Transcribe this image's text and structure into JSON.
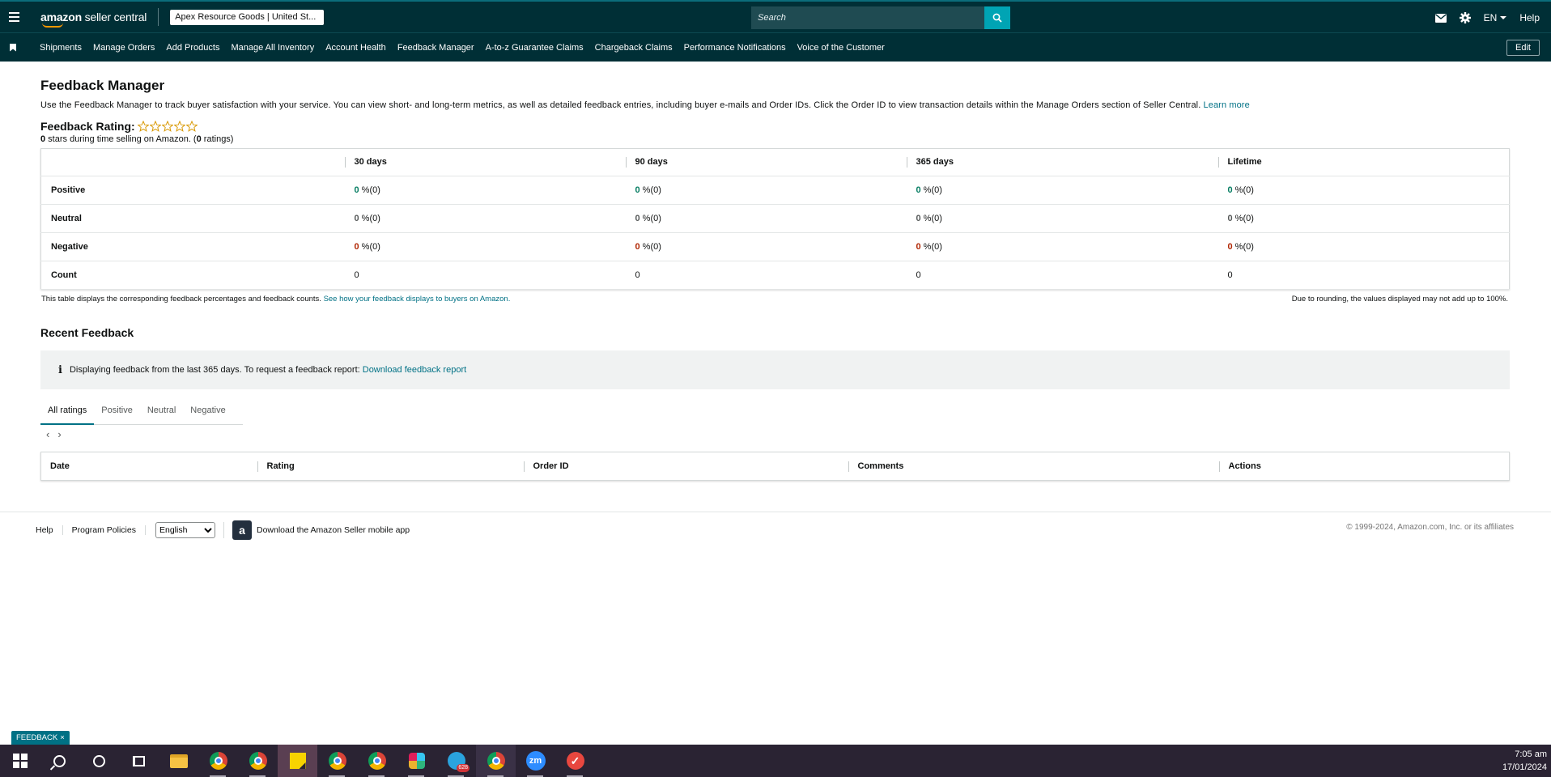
{
  "header": {
    "logo_main": "amazon",
    "logo_sub": " seller central",
    "account": "Apex Resource Goods | United St...",
    "search_placeholder": "Search",
    "lang": "EN",
    "help": "Help"
  },
  "nav": {
    "items": [
      "Shipments",
      "Manage Orders",
      "Add Products",
      "Manage All Inventory",
      "Account Health",
      "Feedback Manager",
      "A-to-z Guarantee Claims",
      "Chargeback Claims",
      "Performance Notifications",
      "Voice of the Customer"
    ],
    "edit": "Edit"
  },
  "page": {
    "title": "Feedback Manager",
    "description": "Use the Feedback Manager to track buyer satisfaction with your service. You can view short- and long-term metrics, as well as detailed feedback entries, including buyer e-mails and Order IDs. Click the Order ID to view transaction details within the Manage Orders section of Seller Central.",
    "learn_more": "Learn more",
    "rating_label": "Feedback Rating:",
    "stars_count": "0",
    "stars_text": " stars during time selling on Amazon. (",
    "ratings_count": "0",
    "ratings_text": " ratings)"
  },
  "feedback_table": {
    "columns": [
      "30 days",
      "90 days",
      "365 days",
      "Lifetime"
    ],
    "rows": [
      {
        "label": "Positive",
        "cells": [
          {
            "n": "0",
            "rest": " %(0)"
          },
          {
            "n": "0",
            "rest": " %(0)"
          },
          {
            "n": "0",
            "rest": " %(0)"
          },
          {
            "n": "0",
            "rest": " %(0)"
          }
        ]
      },
      {
        "label": "Neutral",
        "cells": [
          {
            "n": "0",
            "rest": " %(0)"
          },
          {
            "n": "0",
            "rest": " %(0)"
          },
          {
            "n": "0",
            "rest": " %(0)"
          },
          {
            "n": "0",
            "rest": " %(0)"
          }
        ]
      },
      {
        "label": "Negative",
        "cells": [
          {
            "n": "0",
            "rest": " %(0)"
          },
          {
            "n": "0",
            "rest": " %(0)"
          },
          {
            "n": "0",
            "rest": " %(0)"
          },
          {
            "n": "0",
            "rest": " %(0)"
          }
        ]
      },
      {
        "label": "Count",
        "cells": [
          {
            "n": "",
            "rest": "0"
          },
          {
            "n": "",
            "rest": "0"
          },
          {
            "n": "",
            "rest": "0"
          },
          {
            "n": "",
            "rest": "0"
          }
        ]
      }
    ],
    "note_left": "This table displays the corresponding feedback percentages and feedback counts.",
    "note_link": "See how your feedback displays to buyers on Amazon.",
    "note_right": "Due to rounding, the values displayed may not add up to 100%."
  },
  "recent": {
    "title": "Recent Feedback",
    "info_icon": "info-icon",
    "info_text": "Displaying feedback from the last 365 days. To request a feedback report:",
    "info_link": "Download feedback report",
    "tabs": [
      "All ratings",
      "Positive",
      "Neutral",
      "Negative"
    ],
    "prev": "‹",
    "next": "›",
    "columns": [
      "Date",
      "Rating",
      "Order ID",
      "Comments",
      "Actions"
    ]
  },
  "footer": {
    "help": "Help",
    "policies": "Program Policies",
    "language": "English",
    "app_text": "Download the Amazon Seller mobile app",
    "copyright": "© 1999-2024, Amazon.com, Inc. or its affiliates"
  },
  "feedback_tab": "FEEDBACK",
  "taskbar": {
    "time": "7:05 am",
    "date": "17/01/2024",
    "zoom_label": "zm",
    "telegram_badge": "628"
  },
  "colors": {
    "header_bg": "#002f36",
    "accent": "#007185",
    "positive": "#067d62",
    "negative": "#b12704",
    "star": "#d99a06"
  }
}
